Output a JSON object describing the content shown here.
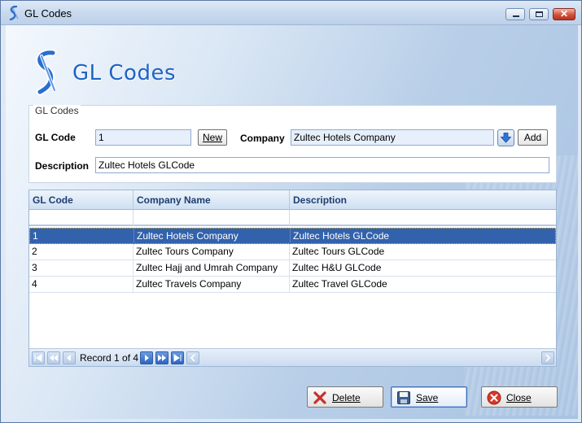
{
  "window": {
    "title": "GL Codes"
  },
  "header": {
    "title": "GL Codes"
  },
  "form": {
    "group_title": "GL Codes",
    "gl_code_label": "GL Code",
    "gl_code_value": "1",
    "new_label": "New",
    "company_label": "Company",
    "company_value": "Zultec Hotels Company",
    "add_label": "Add",
    "description_label": "Description",
    "description_value": "Zultec Hotels GLCode"
  },
  "grid": {
    "columns": [
      "GL Code",
      "Company Name",
      "Description"
    ],
    "rows": [
      {
        "code": "1",
        "company": "Zultec Hotels Company",
        "description": "Zultec Hotels GLCode",
        "selected": true
      },
      {
        "code": "2",
        "company": "Zultec Tours Company",
        "description": "Zultec Tours GLCode",
        "selected": false
      },
      {
        "code": "3",
        "company": "Zultec Hajj and Umrah Company",
        "description": "Zultec H&U GLCode",
        "selected": false
      },
      {
        "code": "4",
        "company": "Zultec Travels Company",
        "description": "Zultec Travel GLCode",
        "selected": false
      }
    ],
    "navigator_text": "Record 1 of 4"
  },
  "actions": {
    "delete_label": "Delete",
    "save_label": "Save",
    "close_label": "Close"
  },
  "colors": {
    "accent": "#1f63c2",
    "selected_row": "#3262ac",
    "header_text": "#1d3d70"
  },
  "icons": [
    "app-icon",
    "minimize-icon",
    "maximize-icon",
    "close-icon",
    "dropdown-arrow-icon",
    "delete-x-icon",
    "save-disk-icon",
    "close-circle-icon"
  ]
}
